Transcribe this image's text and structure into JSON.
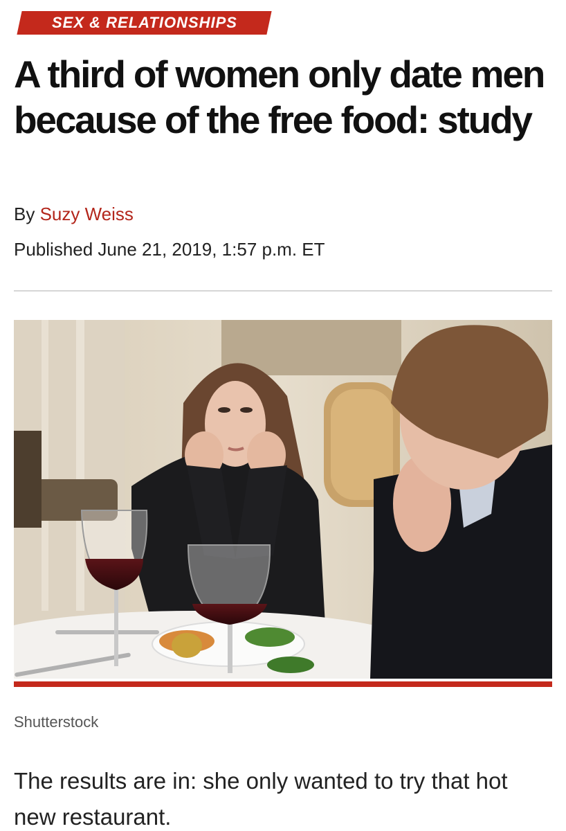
{
  "section": {
    "label": "SEX & RELATIONSHIPS"
  },
  "article": {
    "headline": "A third of women only date men because of the free food: study",
    "byline_prefix": "By ",
    "author": "Suzy Weiss",
    "published": "Published June 21, 2019, 1:57 p.m. ET",
    "image_credit": "Shutterstock",
    "lede": "The results are in: she only wanted to try that hot new restaurant."
  },
  "colors": {
    "accent": "#c4291c",
    "author_link": "#b3261b",
    "divider": "#d6d6d6"
  }
}
